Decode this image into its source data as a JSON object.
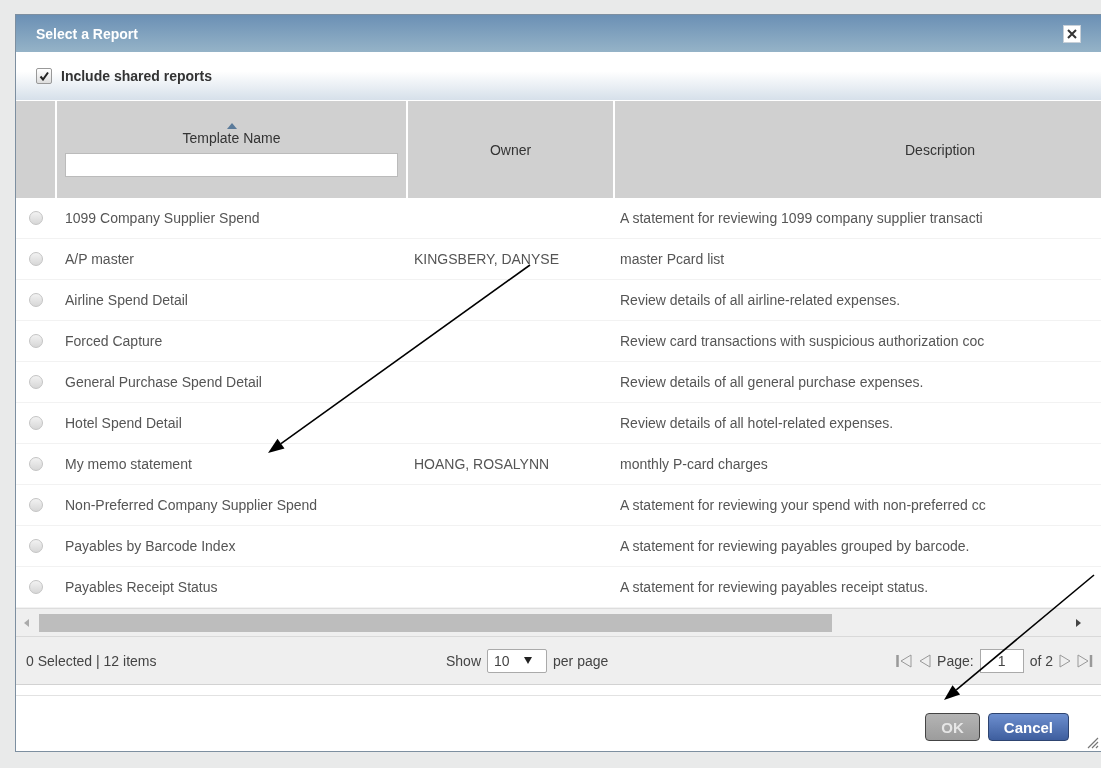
{
  "dialog": {
    "title": "Select a Report",
    "include_shared": {
      "label": "Include shared reports",
      "checked": true
    },
    "table": {
      "columns": [
        {
          "label": "Template Name",
          "sorted": true,
          "filter": true
        },
        {
          "label": "Owner",
          "sorted": false,
          "filter": false
        },
        {
          "label": "Description",
          "sorted": false,
          "filter": false
        }
      ],
      "rows": [
        {
          "selected": false,
          "template_name": "1099 Company Supplier Spend",
          "description": "A statement for reviewing 1099 company supplier transacti"
        },
        {
          "selected": false,
          "template_name": "A/P master",
          "owner": "KINGSBERY, DANYSE",
          "description": "master Pcard list"
        },
        {
          "selected": false,
          "template_name": "Airline Spend Detail",
          "description": "Review details of all airline-related expenses."
        },
        {
          "selected": false,
          "template_name": "Forced Capture",
          "description": "Review card transactions with suspicious authorization coc"
        },
        {
          "selected": false,
          "template_name": "General Purchase Spend Detail",
          "description": "Review details of all general purchase expenses."
        },
        {
          "selected": false,
          "template_name": "Hotel Spend Detail",
          "description": "Review details of all hotel-related expenses."
        },
        {
          "selected": false,
          "template_name": "My memo statement",
          "owner": "HOANG, ROSALYNN",
          "description": "monthly P-card charges"
        },
        {
          "selected": false,
          "template_name": "Non-Preferred Company Supplier Spend",
          "description": "A statement for reviewing your spend with non-preferred cc"
        },
        {
          "selected": false,
          "template_name": "Payables by Barcode Index",
          "description": "A statement for reviewing payables grouped by barcode."
        },
        {
          "selected": false,
          "template_name": "Payables Receipt Status",
          "description": "A statement for reviewing payables receipt status."
        }
      ]
    },
    "footer": {
      "status": "0 Selected | 12 items",
      "show_label": "Show",
      "page_size": "10",
      "per_page_label": "per page",
      "page_label": "Page:",
      "page": "1",
      "of_label": "of 2"
    },
    "buttons": [
      {
        "label": "OK",
        "kind": "primary",
        "disabled": true
      },
      {
        "label": "Cancel",
        "kind": "secondary",
        "disabled": false
      }
    ]
  }
}
